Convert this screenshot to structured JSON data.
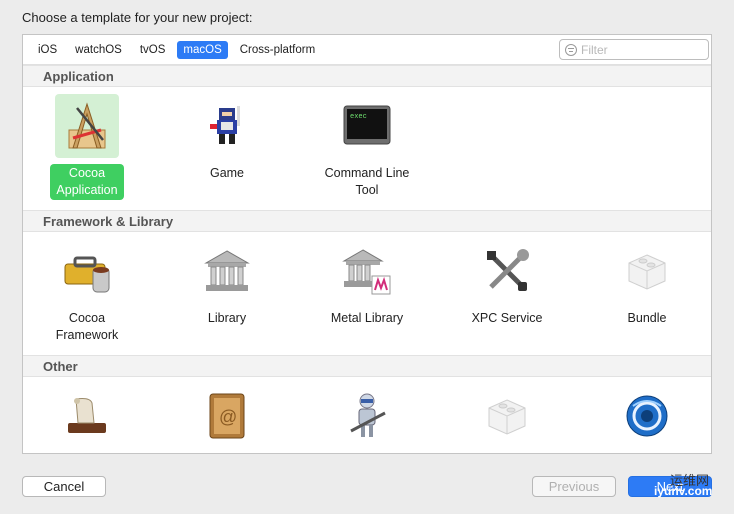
{
  "dialog": {
    "title": "Choose a template for your new project:"
  },
  "platform_tabs": [
    "iOS",
    "watchOS",
    "tvOS",
    "macOS",
    "Cross-platform"
  ],
  "active_tab": "macOS",
  "filter": {
    "placeholder": "Filter"
  },
  "sections": [
    {
      "title": "Application",
      "items": [
        {
          "label": "Cocoa Application",
          "icon": "cocoa-app-icon",
          "selected": true
        },
        {
          "label": "Game",
          "icon": "game-icon"
        },
        {
          "label": "Command Line Tool",
          "icon": "terminal-icon",
          "icon_text": "exec"
        }
      ]
    },
    {
      "title": "Framework & Library",
      "items": [
        {
          "label": "Cocoa Framework",
          "icon": "toolbox-icon"
        },
        {
          "label": "Library",
          "icon": "library-building-icon"
        },
        {
          "label": "Metal Library",
          "icon": "metal-library-icon"
        },
        {
          "label": "XPC Service",
          "icon": "tools-icon"
        },
        {
          "label": "Bundle",
          "icon": "bundle-lego-icon"
        }
      ]
    },
    {
      "title": "Other",
      "items": [
        {
          "icon": "scroll-icon"
        },
        {
          "icon": "address-book-icon"
        },
        {
          "icon": "automator-robot-icon"
        },
        {
          "icon": "bundle-lego-icon"
        },
        {
          "icon": "blue-sphere-icon"
        }
      ]
    }
  ],
  "buttons": {
    "cancel": "Cancel",
    "previous": "Previous",
    "next": "Next"
  },
  "watermark": {
    "top": "运维网",
    "bottom": "iyunv.com"
  },
  "colors": {
    "accent": "#2d7bf5",
    "selected_label": "#3fcf61",
    "selected_bg": "#d4f0d4"
  }
}
